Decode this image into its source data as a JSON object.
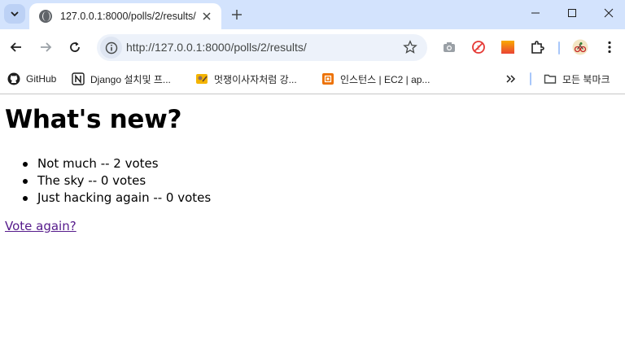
{
  "browser": {
    "tab": {
      "title": "127.0.0.1:8000/polls/2/results/"
    },
    "omnibox": {
      "url": "http://127.0.0.1:8000/polls/2/results/"
    },
    "bookmarks": [
      {
        "label": "GitHub",
        "icon": "github-icon"
      },
      {
        "label": "Django 설치및 프...",
        "icon": "notion-icon"
      },
      {
        "label": "멋쟁이사자처럼 강...",
        "icon": "lion-icon"
      },
      {
        "label": "인스턴스 | EC2 | ap...",
        "icon": "aws-icon"
      }
    ],
    "all_bookmarks_label": "모든 북마크"
  },
  "page": {
    "heading": "What's new?",
    "choices": [
      {
        "text": "Not much -- 2 votes"
      },
      {
        "text": "The sky -- 0 votes"
      },
      {
        "text": "Just hacking again -- 0 votes"
      }
    ],
    "vote_again_link": "Vote again?"
  },
  "colors": {
    "chrome_bg": "#d3e3fd",
    "link_visited": "#551a8b",
    "omnibox_bg": "#edf2fa"
  }
}
